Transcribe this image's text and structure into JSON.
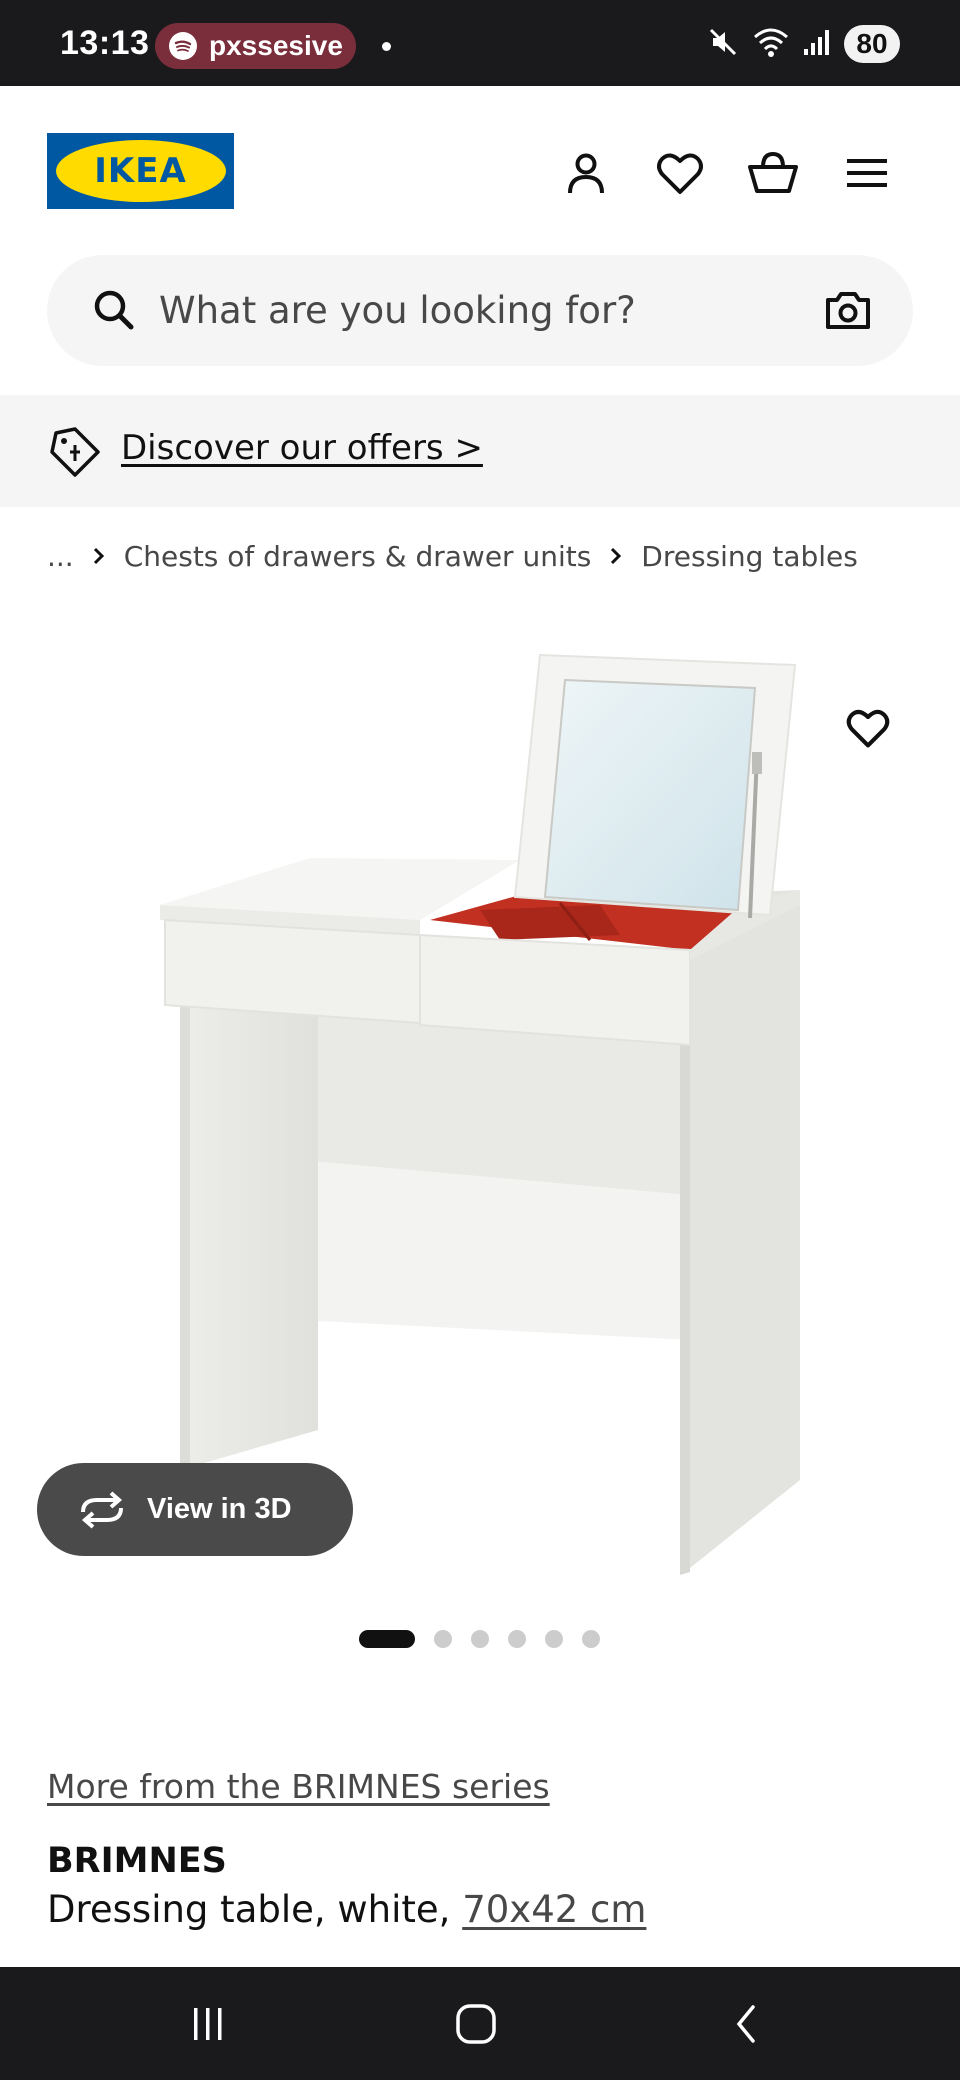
{
  "status_bar": {
    "time": "13:13",
    "notification_app": "pxssesive",
    "battery": "80"
  },
  "header": {
    "logo_text": "IKEA",
    "icons": [
      "account-icon",
      "heart-icon",
      "shopping-basket-icon",
      "menu-icon"
    ]
  },
  "search": {
    "placeholder": "What are you looking for?"
  },
  "offers": {
    "link_text": "Discover our offers >"
  },
  "breadcrumb": {
    "items": [
      "...",
      "Chests of drawers & drawer units",
      "Dressing tables"
    ]
  },
  "gallery": {
    "view_3d_label": "View in 3D",
    "slide_count": 6,
    "active_slide": 1
  },
  "product": {
    "series_link": "More from the BRIMNES series",
    "name": "BRIMNES",
    "description": "Dressing table, white,",
    "size": "70x42 cm"
  },
  "colors": {
    "ikea_blue": "#0058a3",
    "ikea_yellow": "#ffdb00",
    "status_pill": "#7a2e3c",
    "view_3d_bg": "#4a4a4a"
  }
}
